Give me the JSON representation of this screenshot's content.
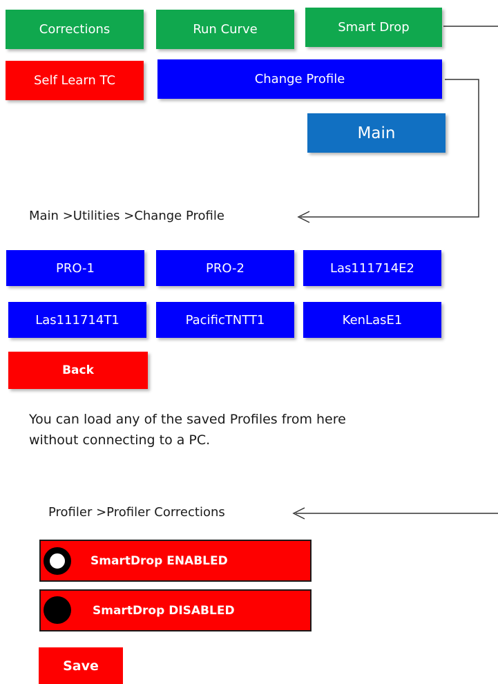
{
  "top_menu": {
    "corrections": "Corrections",
    "run_curve": "Run Curve",
    "smart_drop": "Smart Drop",
    "self_learn_tc": "Self Learn TC",
    "change_profile": "Change Profile",
    "main": "Main"
  },
  "change_profile_screen": {
    "breadcrumb": "Main >Utilities >Change Profile",
    "profiles": [
      "PRO-1",
      "PRO-2",
      "Las111714E2",
      "Las111714T1",
      "PacificTNTT1",
      "KenLasE1"
    ],
    "back": "Back",
    "description": "You can load any of the saved Profiles from here without connecting to a PC."
  },
  "profiler_screen": {
    "breadcrumb": "Profiler >Profiler Corrections",
    "options": [
      {
        "label": "SmartDrop ENABLED",
        "selected": true
      },
      {
        "label": "SmartDrop DISABLED",
        "selected": false
      }
    ],
    "save": "Save"
  },
  "colors": {
    "green": "#10a84e",
    "red": "#fe0000",
    "blue": "#0000fe",
    "steel_blue": "#1170c2"
  }
}
